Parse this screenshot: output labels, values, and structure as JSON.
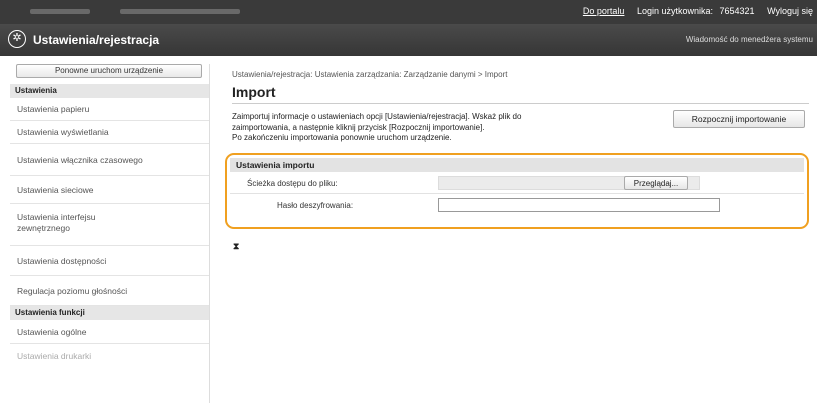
{
  "topbar": {
    "portal_link": "Do portalu",
    "login_label": "Login użytkownika:",
    "user_id": "7654321",
    "logout_link": "Wyloguj się"
  },
  "header": {
    "title": "Ustawienia/rejestracja",
    "message_link": "Wiadomość do menedżera systemu"
  },
  "sidebar": {
    "restart_button": "Ponowne uruchom urządzenie",
    "sections": [
      {
        "heading": "Ustawienia",
        "items": [
          {
            "label": "Ustawienia papieru"
          },
          {
            "label": "Ustawienia wyświetlania"
          },
          {
            "label": "Ustawienia włącznika czasowego"
          },
          {
            "label": "Ustawienia sieciowe"
          },
          {
            "label": "Ustawienia interfejsu zewnętrznego"
          },
          {
            "label": "Ustawienia dostępności"
          },
          {
            "label": "Regulacja poziomu głośności"
          }
        ]
      },
      {
        "heading": "Ustawienia funkcji",
        "items": [
          {
            "label": "Ustawienia ogólne"
          },
          {
            "label": "Ustawienia drukarki"
          }
        ]
      }
    ]
  },
  "main": {
    "breadcrumb": "Ustawienia/rejestracja: Ustawienia zarządzania: Zarządzanie danymi > Import",
    "title": "Import",
    "description_line1": "Zaimportuj informacje o ustawieniach opcji [Ustawienia/rejestracja]. Wskaż plik do",
    "description_line2": "zaimportowania, a następnie kliknij przycisk [Rozpocznij importowanie].",
    "description_line3": "Po zakończeniu importowania ponownie uruchom urządzenie.",
    "start_button": "Rozpocznij importowanie",
    "settings": {
      "heading": "Ustawienia importu",
      "file_path_label": "Ścieżka dostępu do pliku:",
      "browse_button": "Przeglądaj...",
      "password_label": "Hasło deszyfrowania:",
      "password_value": ""
    },
    "top_link": "⧗"
  },
  "colors": {
    "topbar_bg": "#3a3a3a",
    "header_bg": "#3f3f3f",
    "highlight": "#f0a020"
  }
}
